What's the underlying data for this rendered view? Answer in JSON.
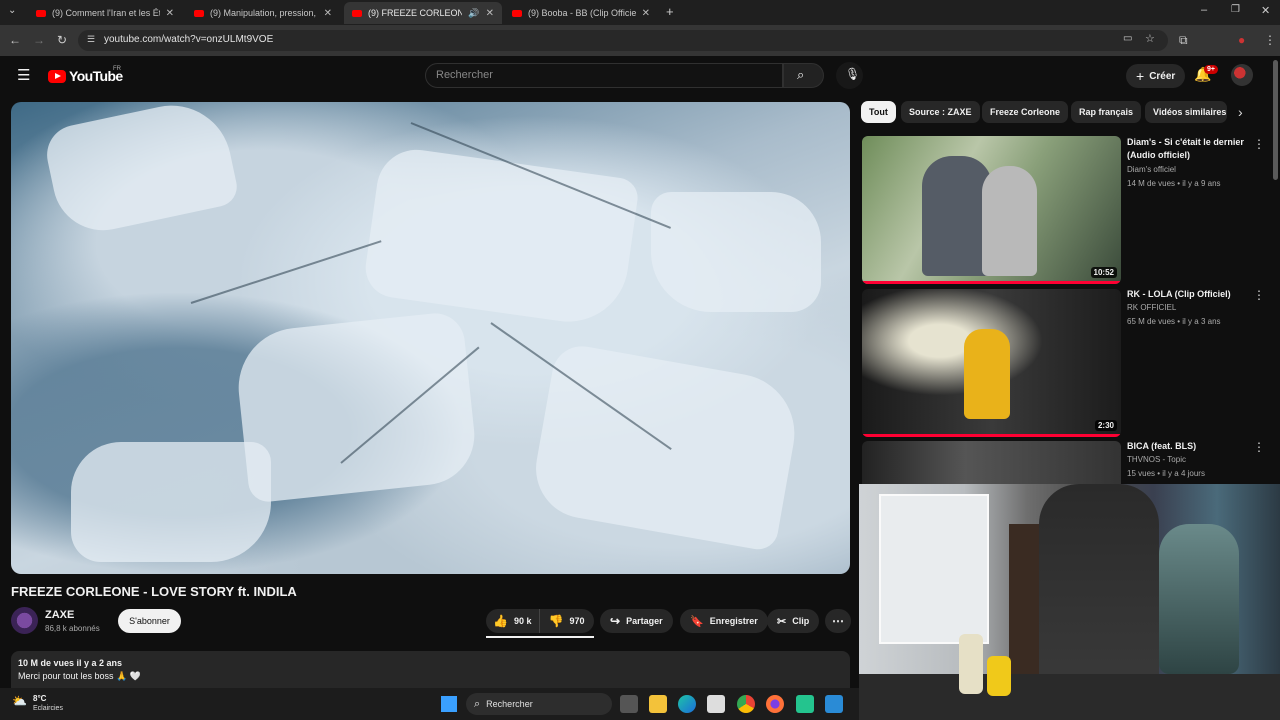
{
  "browser": {
    "tabs": [
      {
        "title": "(9) Comment l'Iran et les États-",
        "active": false
      },
      {
        "title": "(9) Manipulation, pression, vers",
        "active": false
      },
      {
        "title": "(9) FREEZE CORLEONE - LO",
        "active": true
      },
      {
        "title": "(9) Booba - BB (Clip Officiel) - Y",
        "active": false
      }
    ],
    "url": "youtube.com/watch?v=onzULMt9VOE"
  },
  "youtube": {
    "logo_text": "YouTube",
    "region": "FR",
    "search_placeholder": "Rechercher",
    "create_label": "Créer",
    "notification_count": "9+"
  },
  "video": {
    "title": "FREEZE CORLEONE - LOVE STORY ft. INDILA",
    "channel": "ZAXE",
    "subscribers": "86,8 k abonnés",
    "subscribe_label": "S'abonner",
    "likes": "90 k",
    "dislikes": "970",
    "share_label": "Partager",
    "save_label": "Enregistrer",
    "clip_label": "Clip",
    "views_age": "10 M de vues  il y a 2 ans",
    "description": "Merci pour tout les boss 🙏 🤍"
  },
  "chips": [
    "Tout",
    "Source : ZAXE",
    "Freeze Corleone",
    "Rap français",
    "Vidéos similaires"
  ],
  "recommendations": [
    {
      "title": "Diam's - Si c'était le dernier (Audio officiel)",
      "channel": "Diam's officiel",
      "meta": "14 M de vues • il y a 9 ans",
      "duration": "10:52"
    },
    {
      "title": "RK - LOLA (Clip Officiel)",
      "channel": "RK OFFICIEL",
      "meta": "65 M de vues • il y a 3 ans",
      "duration": "2:30"
    },
    {
      "title": "BICA (feat. BLS)",
      "channel": "THVNOS - Topic",
      "meta": "15 vues • il y a 4 jours",
      "duration": ""
    }
  ],
  "taskbar": {
    "temperature": "8°C",
    "weather": "Eclaircies",
    "search_label": "Rechercher"
  },
  "colors": {
    "brand_red": "#ff0000",
    "background": "#0f0f0f",
    "chip_bg": "#272727"
  }
}
